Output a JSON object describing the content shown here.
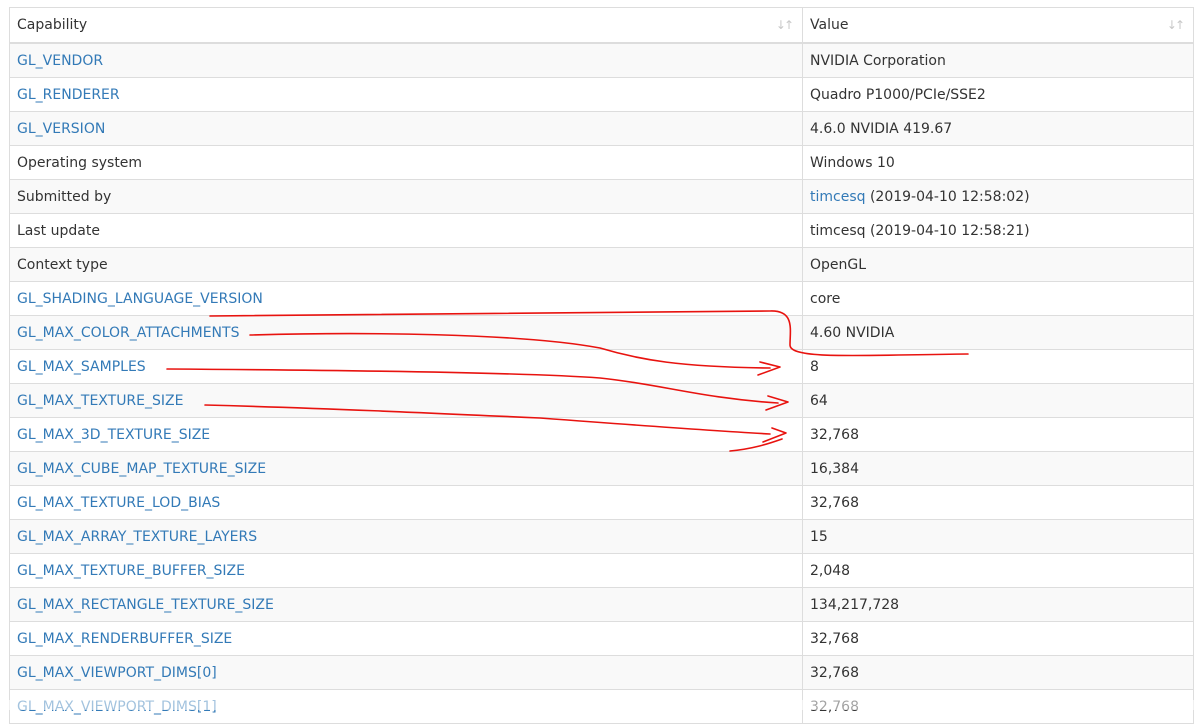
{
  "table": {
    "headers": [
      {
        "label": "Capability",
        "sort_icon": "sort-arrows-icon"
      },
      {
        "label": "Value",
        "sort_icon": "sort-arrows-icon"
      }
    ],
    "rows": [
      {
        "capability": "GL_VENDOR",
        "capability_is_link": true,
        "value": "NVIDIA Corporation"
      },
      {
        "capability": "GL_RENDERER",
        "capability_is_link": true,
        "value": "Quadro P1000/PCIe/SSE2"
      },
      {
        "capability": "GL_VERSION",
        "capability_is_link": true,
        "value": "4.6.0 NVIDIA 419.67"
      },
      {
        "capability": "Operating system",
        "capability_is_link": false,
        "value": "Windows 10"
      },
      {
        "capability": "Submitted by",
        "capability_is_link": false,
        "value_link": "timcesq",
        "value": " (2019-04-10 12:58:02)"
      },
      {
        "capability": "Last update",
        "capability_is_link": false,
        "value": "timcesq (2019-04-10 12:58:21)"
      },
      {
        "capability": "Context type",
        "capability_is_link": false,
        "value": "OpenGL"
      },
      {
        "capability": "GL_SHADING_LANGUAGE_VERSION",
        "capability_is_link": true,
        "value": "core"
      },
      {
        "capability": "GL_MAX_COLOR_ATTACHMENTS",
        "capability_is_link": true,
        "value": "4.60 NVIDIA"
      },
      {
        "capability": "GL_MAX_SAMPLES",
        "capability_is_link": true,
        "value": "8"
      },
      {
        "capability": "GL_MAX_TEXTURE_SIZE",
        "capability_is_link": true,
        "value": "64"
      },
      {
        "capability": "GL_MAX_3D_TEXTURE_SIZE",
        "capability_is_link": true,
        "value": "32,768"
      },
      {
        "capability": "GL_MAX_CUBE_MAP_TEXTURE_SIZE",
        "capability_is_link": true,
        "value": "16,384"
      },
      {
        "capability": "GL_MAX_TEXTURE_LOD_BIAS",
        "capability_is_link": true,
        "value": "32,768"
      },
      {
        "capability": "GL_MAX_ARRAY_TEXTURE_LAYERS",
        "capability_is_link": true,
        "value": "15"
      },
      {
        "capability": "GL_MAX_TEXTURE_BUFFER_SIZE",
        "capability_is_link": true,
        "value": "2,048"
      },
      {
        "capability": "GL_MAX_RECTANGLE_TEXTURE_SIZE",
        "capability_is_link": true,
        "value": "134,217,728"
      },
      {
        "capability": "GL_MAX_RENDERBUFFER_SIZE",
        "capability_is_link": true,
        "value": "32,768"
      },
      {
        "capability": "GL_MAX_VIEWPORT_DIMS[0]",
        "capability_is_link": true,
        "value": "32,768"
      },
      {
        "capability": "GL_MAX_VIEWPORT_DIMS[1]",
        "capability_is_link": true,
        "value": "32,768"
      }
    ]
  },
  "colors": {
    "link": "#337ab7",
    "text": "#333333",
    "border": "#dddddd",
    "row_stripe": "#f9f9f9",
    "annotation": "#e8130f"
  }
}
